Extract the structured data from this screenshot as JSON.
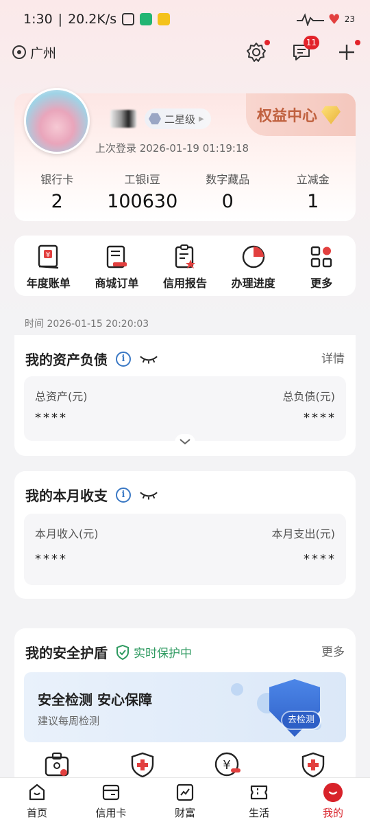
{
  "status_bar": {
    "time": "1:30",
    "speed": "20.2K/s",
    "battery": "23"
  },
  "header": {
    "city": "广州",
    "message_badge": "11"
  },
  "profile": {
    "level": "二星级",
    "last_login": "上次登录 2026-01-19 01:19:18",
    "rights_center": "权益中心",
    "stats": [
      {
        "label": "银行卡",
        "value": "2"
      },
      {
        "label": "工银i豆",
        "value": "100630"
      },
      {
        "label": "数字藏品",
        "value": "0"
      },
      {
        "label": "立减金",
        "value": "1"
      }
    ]
  },
  "quick_actions": [
    {
      "label": "年度账单",
      "icon": "annual-bill-icon"
    },
    {
      "label": "商城订单",
      "icon": "mall-order-icon"
    },
    {
      "label": "信用报告",
      "icon": "credit-report-icon"
    },
    {
      "label": "办理进度",
      "icon": "progress-icon"
    },
    {
      "label": "更多",
      "icon": "more-grid-icon"
    }
  ],
  "timestamp": "时间 2026-01-15 20:20:03",
  "assets": {
    "title": "我的资产负债",
    "detail_link": "详情",
    "total_assets_label": "总资产(元)",
    "total_liabilities_label": "总负债(元)",
    "total_assets_value": "****",
    "total_liabilities_value": "****"
  },
  "monthly": {
    "title": "我的本月收支",
    "income_label": "本月收入(元)",
    "expense_label": "本月支出(元)",
    "income_value": "****",
    "expense_value": "****"
  },
  "security": {
    "title": "我的安全护盾",
    "status": "实时保护中",
    "more_link": "更多",
    "banner_title": "安全检测 安心保障",
    "banner_subtitle": "建议每周检测",
    "banner_button": "去检测"
  },
  "tabs": [
    {
      "label": "首页",
      "icon": "home-icon"
    },
    {
      "label": "信用卡",
      "icon": "credit-card-icon"
    },
    {
      "label": "财富",
      "icon": "wealth-chart-icon"
    },
    {
      "label": "生活",
      "icon": "ticket-icon"
    },
    {
      "label": "我的",
      "icon": "profile-icon",
      "active": true
    }
  ],
  "colors": {
    "brand_red": "#d8222a",
    "safe_green": "#2e9a60",
    "info_blue": "#3a78c4"
  }
}
